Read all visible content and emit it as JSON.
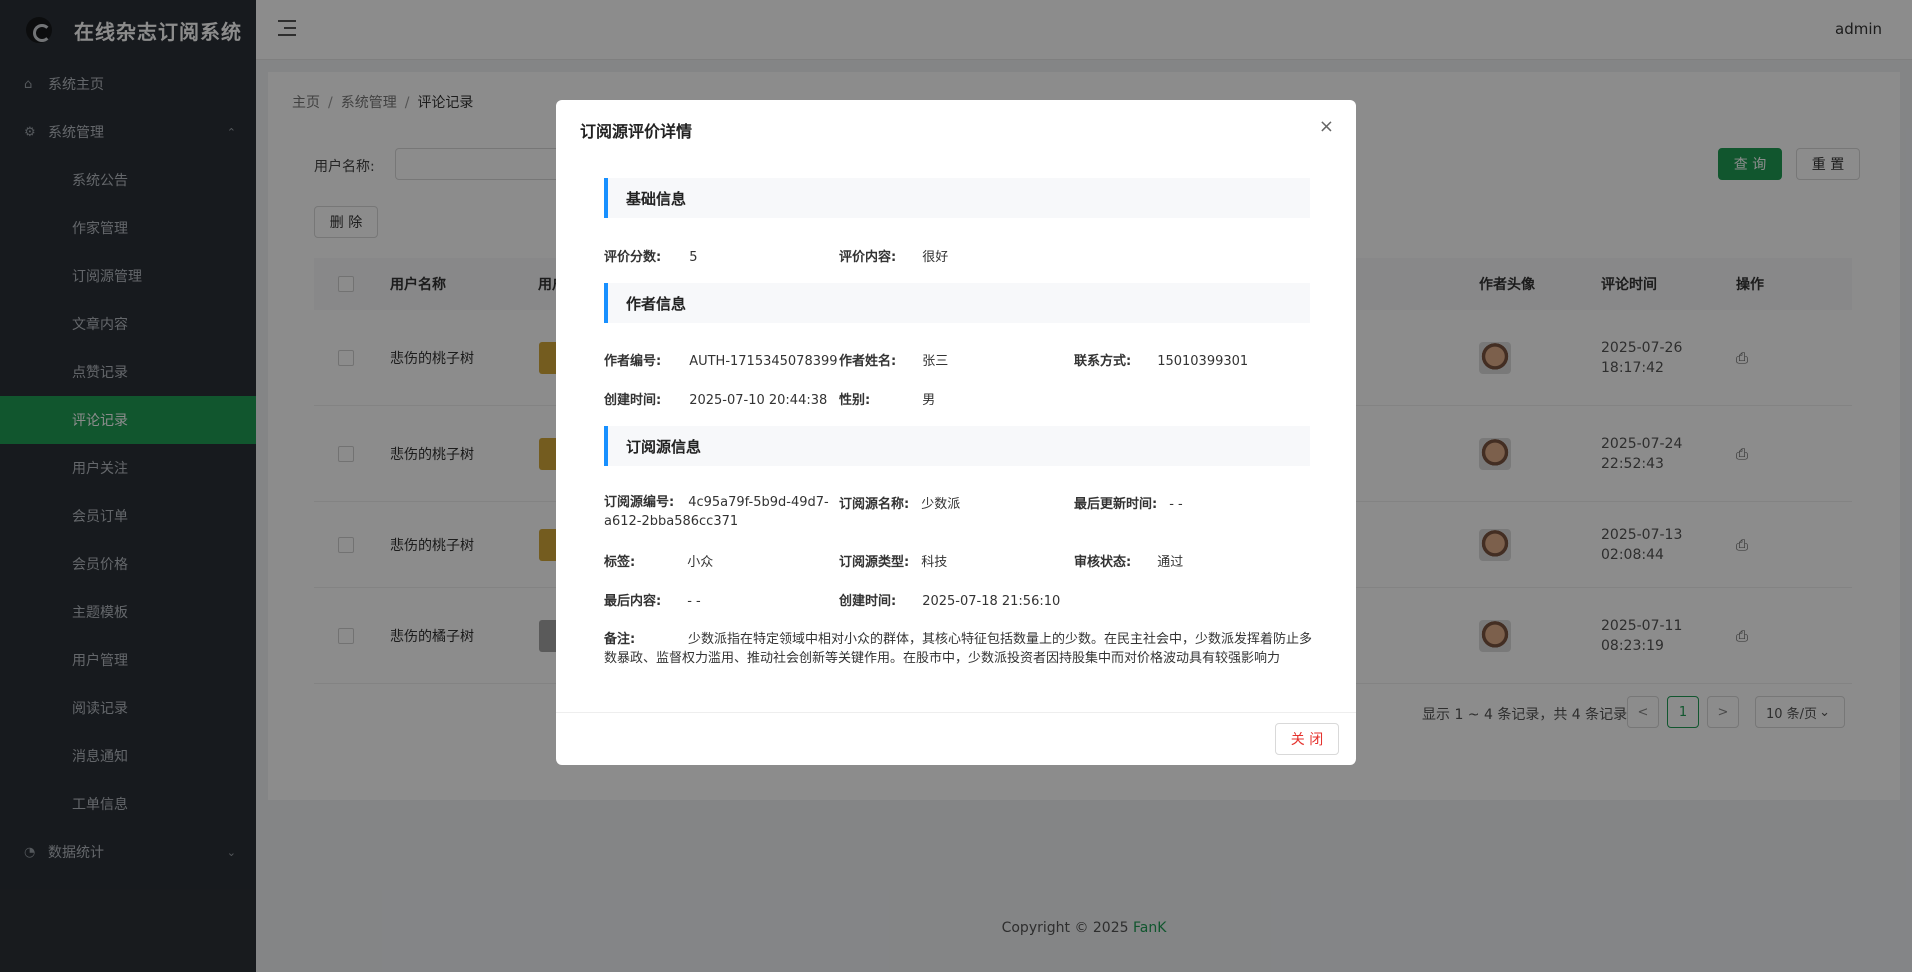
{
  "app": {
    "title": "在线杂志订阅系统"
  },
  "header": {
    "user": "admin"
  },
  "sidebar": {
    "home": "系统主页",
    "system": "系统管理",
    "items": [
      "系统公告",
      "作家管理",
      "订阅源管理",
      "文章内容",
      "点赞记录",
      "评论记录",
      "用户关注",
      "会员订单",
      "会员价格",
      "主题模板",
      "用户管理",
      "阅读记录",
      "消息通知",
      "工单信息"
    ],
    "stats": "数据统计"
  },
  "breadcrumb": [
    "主页",
    "系统管理",
    "评论记录"
  ],
  "search": {
    "label": "用户名称:",
    "value": "",
    "query": "查 询",
    "reset": "重 置"
  },
  "toolbar": {
    "delete": "删 除"
  },
  "table": {
    "headers": [
      "用户名称",
      "用户",
      "作者头像",
      "评论时间",
      "操作"
    ],
    "rows": [
      {
        "name": "悲伤的桃子树",
        "time1": "2025-07-26",
        "time2": "18:17:42"
      },
      {
        "name": "悲伤的桃子树",
        "time1": "2025-07-24",
        "time2": "22:52:43"
      },
      {
        "name": "悲伤的桃子树",
        "time1": "2025-07-13",
        "time2": "02:08:44"
      },
      {
        "name": "悲伤的橘子树",
        "time1": "2025-07-11",
        "time2": "08:23:19"
      }
    ]
  },
  "pagination": {
    "summary": "显示 1 ~ 4 条记录，共 4 条记录",
    "page": "1",
    "size": "10 条/页",
    "prev": "<",
    "next": ">"
  },
  "footer": {
    "text": "Copyright © 2025 ",
    "brand": "FanK"
  },
  "modal": {
    "title": "订阅源评价详情",
    "close_icon": "×",
    "sections": {
      "basic": "基础信息",
      "author": "作者信息",
      "source": "订阅源信息"
    },
    "basic": {
      "score_label": "评价分数:",
      "score": "5",
      "content_label": "评价内容:",
      "content": "很好"
    },
    "author": {
      "id_label": "作者编号:",
      "id": "AUTH-1715345078399",
      "name_label": "作者姓名:",
      "name": "张三",
      "contact_label": "联系方式:",
      "contact": "15010399301",
      "created_label": "创建时间:",
      "created": "2025-07-10 20:44:38",
      "gender_label": "性别:",
      "gender": "男"
    },
    "source": {
      "id_label": "订阅源编号:",
      "id": "4c95a79f-5b9d-49d7-a612-2bba586cc371",
      "name_label": "订阅源名称:",
      "name": "少数派",
      "updated_label": "最后更新时间:",
      "updated": "- -",
      "tag_label": "标签:",
      "tag": "小众",
      "type_label": "订阅源类型:",
      "type": "科技",
      "status_label": "审核状态:",
      "status": "通过",
      "last_label": "最后内容:",
      "last": "- -",
      "created_label": "创建时间:",
      "created": "2025-07-18 21:56:10",
      "remark_label": "备注:",
      "remark": "少数派指在特定领域中相对小众的群体，其核心特征包括数量上的少数。在民主社会中，少数派发挥着防止多数暴政、监督权力滥用、推动社会创新等关键作用。在股市中，少数派投资者因持股集中而对价格波动具有较强影响力"
    },
    "close_button": "关 闭"
  }
}
